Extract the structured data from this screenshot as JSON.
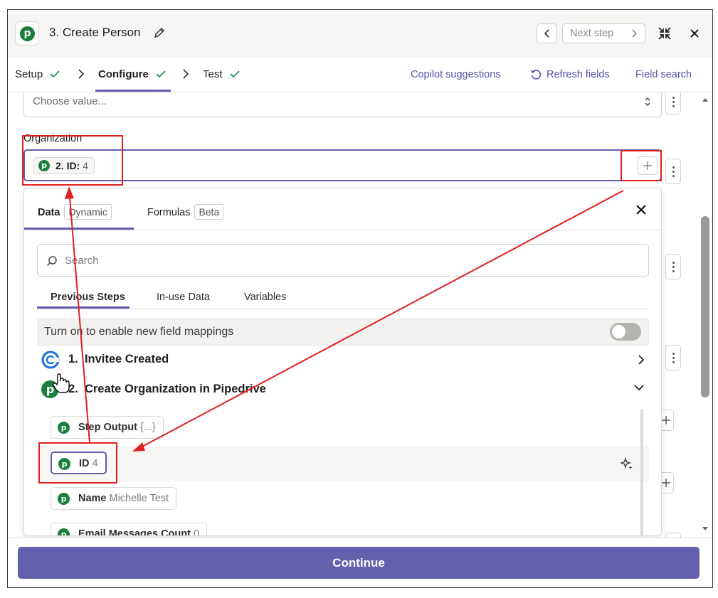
{
  "header": {
    "title": "3. Create Person",
    "next_step_label": "Next step"
  },
  "tabs": [
    {
      "label": "Setup"
    },
    {
      "label": "Configure"
    },
    {
      "label": "Test"
    }
  ],
  "top_links": {
    "copilot": "Copilot suggestions",
    "refresh": "Refresh fields",
    "field_search": "Field search"
  },
  "form": {
    "choose_placeholder": "Choose value...",
    "organization_label": "Organization",
    "org_pill_key": "2. ID:",
    "org_pill_value": "4"
  },
  "popup": {
    "tab_data": "Data",
    "tab_data_badge": "Dynamic",
    "tab_formulas": "Formulas",
    "tab_formulas_badge": "Beta",
    "search_placeholder": "Search",
    "subtabs": [
      "Previous Steps",
      "In-use Data",
      "Variables"
    ],
    "toggle_text": "Turn on to enable new field mappings",
    "steps": [
      {
        "number": "1.",
        "name": "Invitee Created"
      },
      {
        "number": "2.",
        "name": "Create Organization in Pipedrive"
      }
    ],
    "fields": [
      {
        "key": "Step Output",
        "value": "{...}"
      },
      {
        "key": "ID",
        "value": "4"
      },
      {
        "key": "Name",
        "value": "Michelle Test"
      },
      {
        "key": "Email Messages Count",
        "value": "0"
      }
    ]
  },
  "footer": {
    "continue_label": "Continue"
  },
  "colors": {
    "accent": "#625ead",
    "pipedrive_green": "#1a7f3c",
    "annotation_red": "#e02020"
  }
}
